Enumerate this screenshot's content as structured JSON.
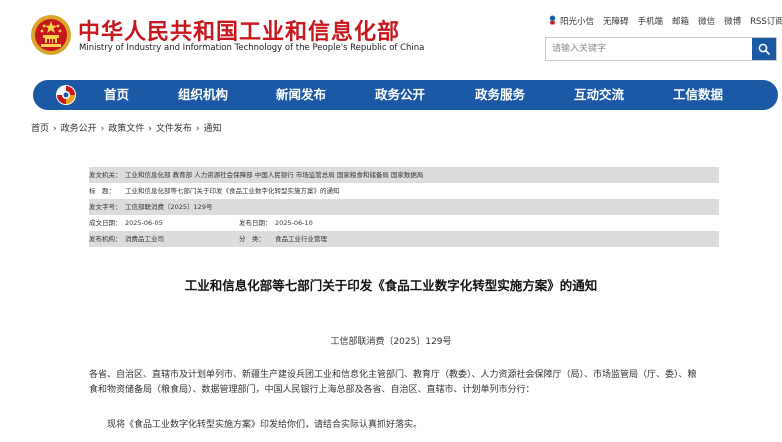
{
  "header": {
    "site_title_cn": "中华人民共和国工业和信息化部",
    "site_title_en": "Ministry of Industry and Information Technology of the People's Republic of China",
    "brand_color": "#c8161d"
  },
  "top_links": [
    "阳光小信",
    "无障碍",
    "手机端",
    "邮箱",
    "微信",
    "微博",
    "RSS订阅"
  ],
  "search": {
    "placeholder": "请输入关键字"
  },
  "nav": {
    "color": "#1b58a5",
    "items": [
      "首页",
      "组织机构",
      "新闻发布",
      "政务公开",
      "政务服务",
      "互动交流",
      "工信数据"
    ]
  },
  "breadcrumb": [
    "首页",
    "政务公开",
    "政策文件",
    "文件发布",
    "通知"
  ],
  "breadcrumb_separator": "›",
  "meta": {
    "issuer_label": "发文机关：",
    "issuer": "工业和信息化部 教育部 人力资源社会保障部 中国人民银行 市场监管总局 国家粮食和储备局 国家数据局",
    "title_label": "标　题：",
    "title": "工业和信息化部等七部门关于印发《食品工业数字化转型实施方案》的通知",
    "number_label": "发文字号：",
    "number": "工信部联消费〔2025〕129号",
    "date_label": "成文日期：",
    "date": "2025-06-05",
    "pub_date_label": "发布日期：",
    "pub_date": "2025-06-10",
    "org_label": "发布机构：",
    "org": "消费品工业司",
    "category_label": "分　类：",
    "category": "食品工业行业管理"
  },
  "document": {
    "title": "工业和信息化部等七部门关于印发《食品工业数字化转型实施方案》的通知",
    "number": "工信部联消费〔2025〕129号",
    "addressee": "各省、自治区、直辖市及计划单列市、新疆生产建设兵团工业和信息化主管部门、教育厅（教委）、人力资源社会保障厅（局）、市场监管局（厅、委）、粮食和物资储备局（粮食局）、数据管理部门，中国人民银行上海总部及各省、自治区、直辖市、计划单列市分行：",
    "body": "现将《食品工业数字化转型实施方案》印发给你们，请结合实际认真抓好落实。"
  }
}
